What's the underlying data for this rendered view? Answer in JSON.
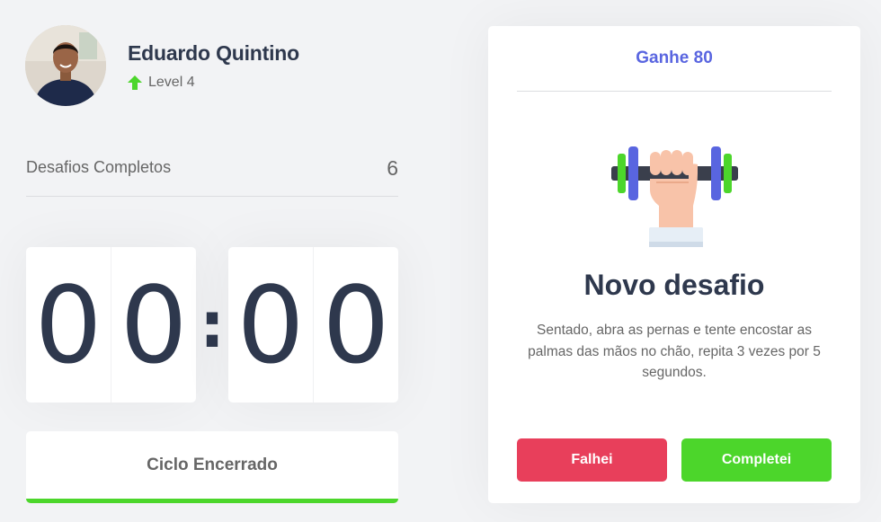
{
  "profile": {
    "name": "Eduardo Quintino",
    "level": "Level 4",
    "level_icon": "arrow-up-icon"
  },
  "completed_challenges": {
    "label": "Desafios Completos",
    "value": "6"
  },
  "countdown": {
    "minute_left": "0",
    "minute_right": "0",
    "separator": ":",
    "second_left": "0",
    "second_right": "0"
  },
  "cycle_button": {
    "label": "Ciclo Encerrado"
  },
  "challenge": {
    "header": "Ganhe 80",
    "illustration": "dumbbell-arm-icon",
    "title": "Novo desafio",
    "description": "Sentado, abra as pernas e tente encostar as palmas das mãos no chão, repita 3 vezes por 5 segundos.",
    "failed_label": "Falhei",
    "succeeded_label": "Completei"
  },
  "colors": {
    "background": "#f2f3f5",
    "title": "#2e384d",
    "text": "#666666",
    "blue": "#5965e0",
    "green": "#4cd62b",
    "red": "#e83f5b",
    "white": "#ffffff"
  }
}
